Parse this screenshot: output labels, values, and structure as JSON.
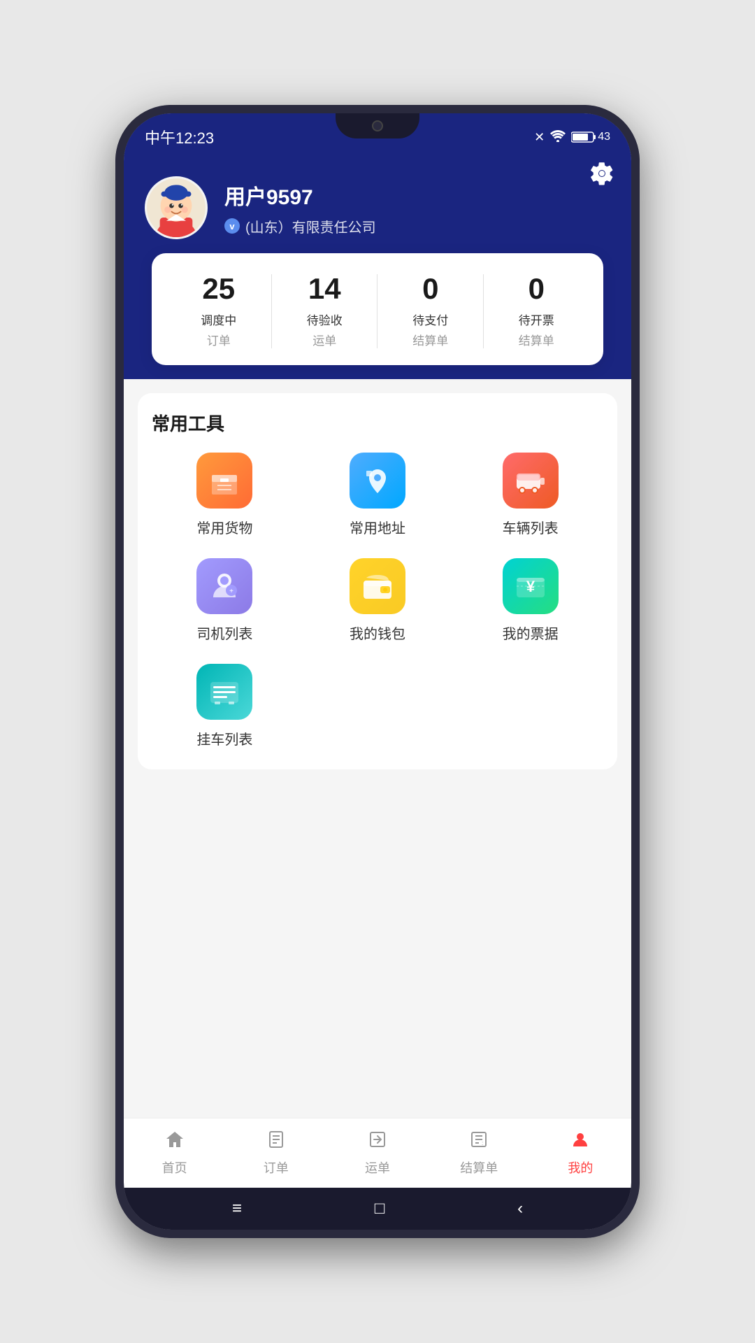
{
  "status_bar": {
    "time": "中午12:23",
    "battery": "43"
  },
  "header": {
    "settings_label": "⚙",
    "username": "用户9597",
    "company": "(山东）有限责任公司",
    "v_badge": "v"
  },
  "stats": [
    {
      "number": "25",
      "label1": "调度中",
      "label2": "订单"
    },
    {
      "number": "14",
      "label1": "待验收",
      "label2": "运单"
    },
    {
      "number": "0",
      "label1": "待支付",
      "label2": "结算单"
    },
    {
      "number": "0",
      "label1": "待开票",
      "label2": "结算单"
    }
  ],
  "tools_section": {
    "title": "常用工具",
    "items": [
      {
        "name": "常用货物",
        "icon_class": "icon-orange",
        "icon": "📦"
      },
      {
        "name": "常用地址",
        "icon_class": "icon-blue",
        "icon": "📍"
      },
      {
        "name": "车辆列表",
        "icon_class": "icon-red",
        "icon": "🚌"
      },
      {
        "name": "司机列表",
        "icon_class": "icon-purple",
        "icon": "👤"
      },
      {
        "name": "我的钱包",
        "icon_class": "icon-yellow",
        "icon": "👛"
      },
      {
        "name": "我的票据",
        "icon_class": "icon-green",
        "icon": "🎫"
      },
      {
        "name": "挂车列表",
        "icon_class": "icon-teal",
        "icon": "📋"
      }
    ]
  },
  "bottom_nav": [
    {
      "label": "首页",
      "icon": "🏠",
      "active": false
    },
    {
      "label": "订单",
      "icon": "📋",
      "active": false
    },
    {
      "label": "运单",
      "icon": "🔄",
      "active": false
    },
    {
      "label": "结算单",
      "icon": "📊",
      "active": false
    },
    {
      "label": "我的",
      "icon": "👤",
      "active": true
    }
  ],
  "system_bar": {
    "menu": "≡",
    "home": "□",
    "back": "‹"
  }
}
